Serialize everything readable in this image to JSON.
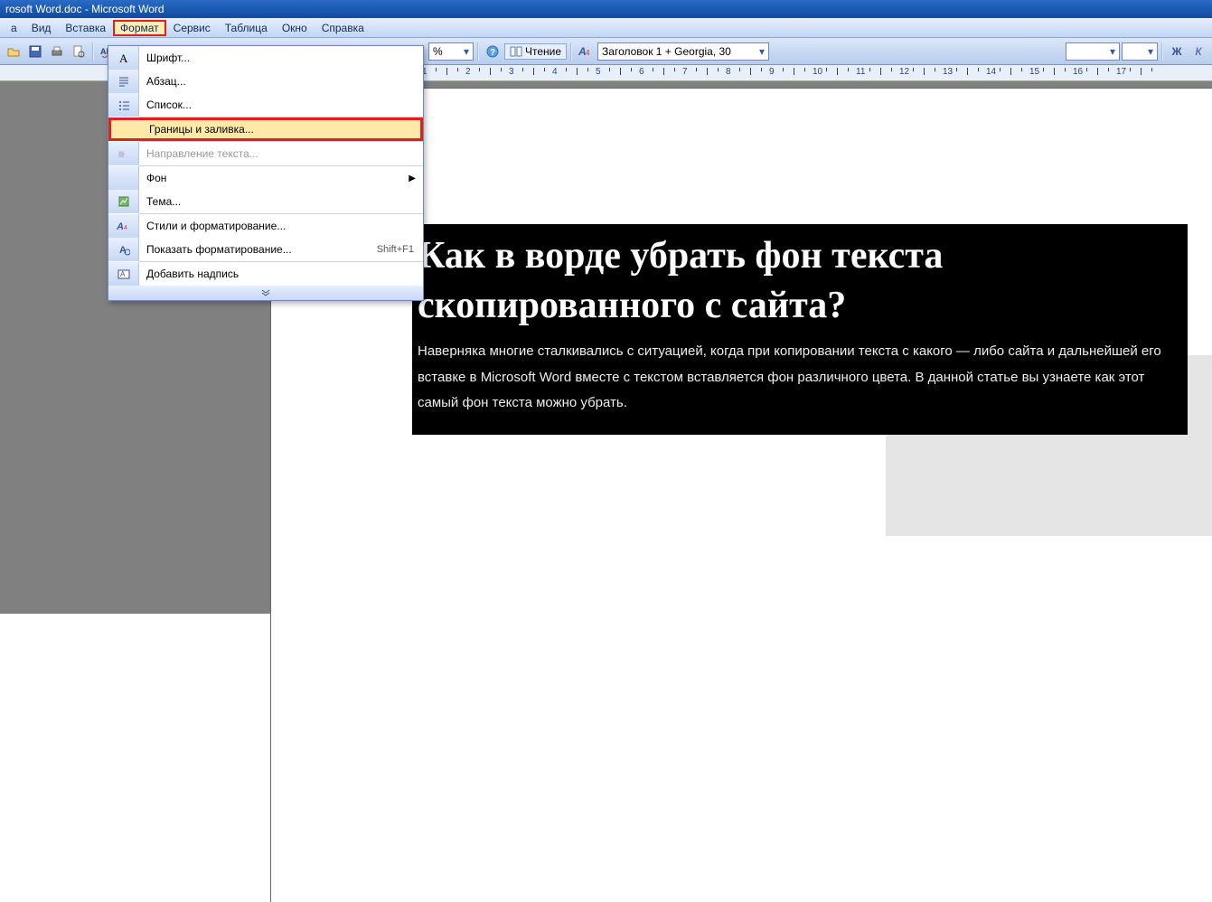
{
  "title": "rosoft Word.doc - Microsoft Word",
  "menubar": {
    "items": [
      "а",
      "Вид",
      "Вставка",
      "Формат",
      "Сервис",
      "Таблица",
      "Окно",
      "Справка"
    ],
    "active_index": 3
  },
  "toolbar": {
    "reading_label": "Чтение",
    "style_label": "Заголовок 1 + Georgia, 30",
    "bold_label": "Ж",
    "italic_label": "К"
  },
  "dropdown": {
    "font": "Шрифт...",
    "paragraph": "Абзац...",
    "list": "Список...",
    "borders": "Границы и заливка...",
    "text_direction": "Направление текста...",
    "background": "Фон",
    "theme": "Тема...",
    "styles": "Стили и форматирование...",
    "reveal": "Показать форматирование...",
    "reveal_shortcut": "Shift+F1",
    "textbox": "Добавить надпись"
  },
  "document": {
    "heading": "Как в ворде убрать фон текста скопированного с сайта?",
    "body": "Наверняка многие сталкивались с ситуацией, когда при копировании текста с какого — либо сайта и дальнейшей его вставке в Microsoft Word вместе с текстом вставляется фон различного цвета. В данной статье вы узнаете как этот самый фон текста можно убрать."
  },
  "ruler": {
    "start": 1,
    "end": 17
  }
}
